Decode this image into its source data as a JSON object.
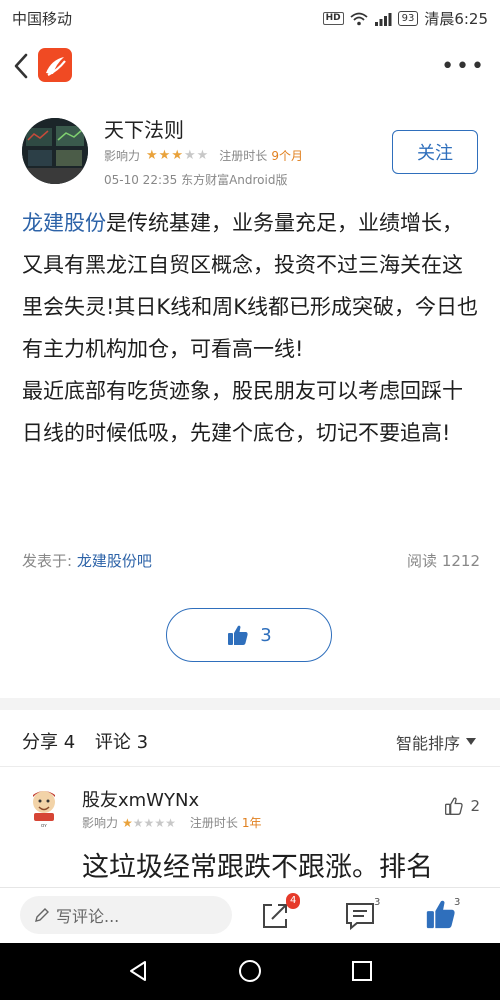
{
  "status": {
    "carrier": "中国移动",
    "hd": "HD",
    "battery": "93",
    "time": "清晨6:25"
  },
  "author": {
    "name": "天下法则",
    "influence_label": "影响力",
    "rating": 3,
    "reg_label": "注册时长",
    "reg_value": "9个月",
    "post_time": "05-10 22:35 东方财富Android版",
    "follow_label": "关注"
  },
  "post": {
    "stock_name": "龙建股份",
    "text1": "是传统基建，业务量充足，业绩增长，又具有黑龙江自贸区概念，投资不过三海关在这里会失灵!其日K线和周K线都已形成突破，今日也有主力机构加仓，可看高一线!",
    "text2": "最近底部有吃货迹象，股民朋友可以考虑回踩十日线的时候低吸，先建个底仓，切记不要追高!",
    "source_label": "发表于:",
    "source_link": "龙建股份吧",
    "reads": "阅读 1212",
    "likes": "3"
  },
  "tabs": {
    "share": "分享 4",
    "comment": "评论 3",
    "sort_label": "智能排序"
  },
  "comment": {
    "name": "股友xmWYNx",
    "influence_label": "影响力",
    "rating": 1,
    "reg_label": "注册时长",
    "reg_value": "1年",
    "likes": "2",
    "text": "这垃圾经常跟跌不跟涨。排名"
  },
  "bottom": {
    "placeholder": "写评论...",
    "share_badge": "4",
    "comment_count": "3",
    "like_count": "3"
  },
  "colors": {
    "accent": "#2f6fbc",
    "brand": "#f04a23",
    "star": "#e9a23b",
    "orange": "#e08020"
  }
}
